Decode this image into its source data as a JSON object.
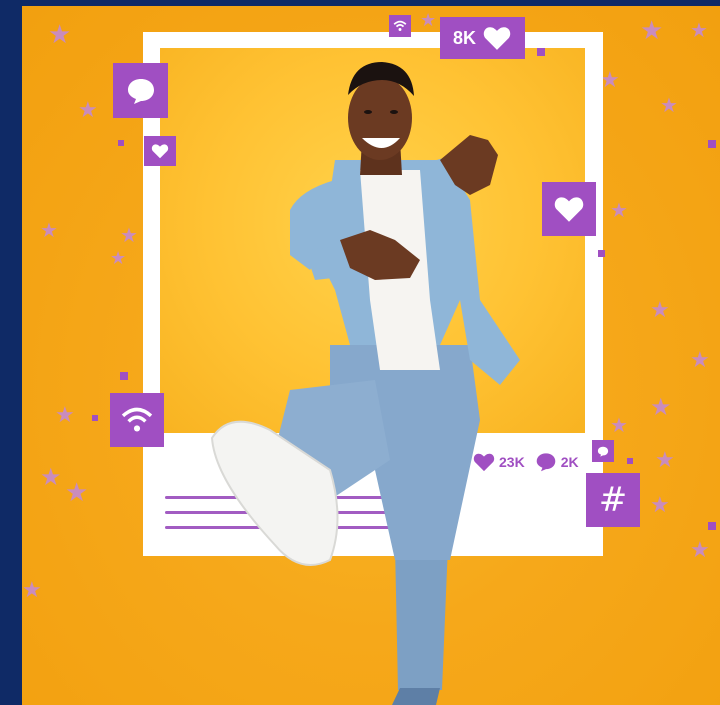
{
  "scene": {
    "colors": {
      "background": "#f6a81a",
      "frame": "#ffffff",
      "accent_purple": "#a04fc2",
      "navy_border": "#0f2a66"
    },
    "followers_badge": {
      "value": "8K",
      "icon": "heart-icon"
    },
    "post_stats": {
      "likes": "23K",
      "likes_icon": "heart-icon",
      "comments": "2K",
      "comments_icon": "comment-bubble-icon"
    },
    "floating_icons": [
      "comment-bubble-icon",
      "heart-icon",
      "heart-icon",
      "wifi-icon",
      "wifi-icon",
      "hashtag-icon",
      "comment-bubble-icon"
    ],
    "subject": "smiling man in denim jacket kicking out of photo frame"
  }
}
